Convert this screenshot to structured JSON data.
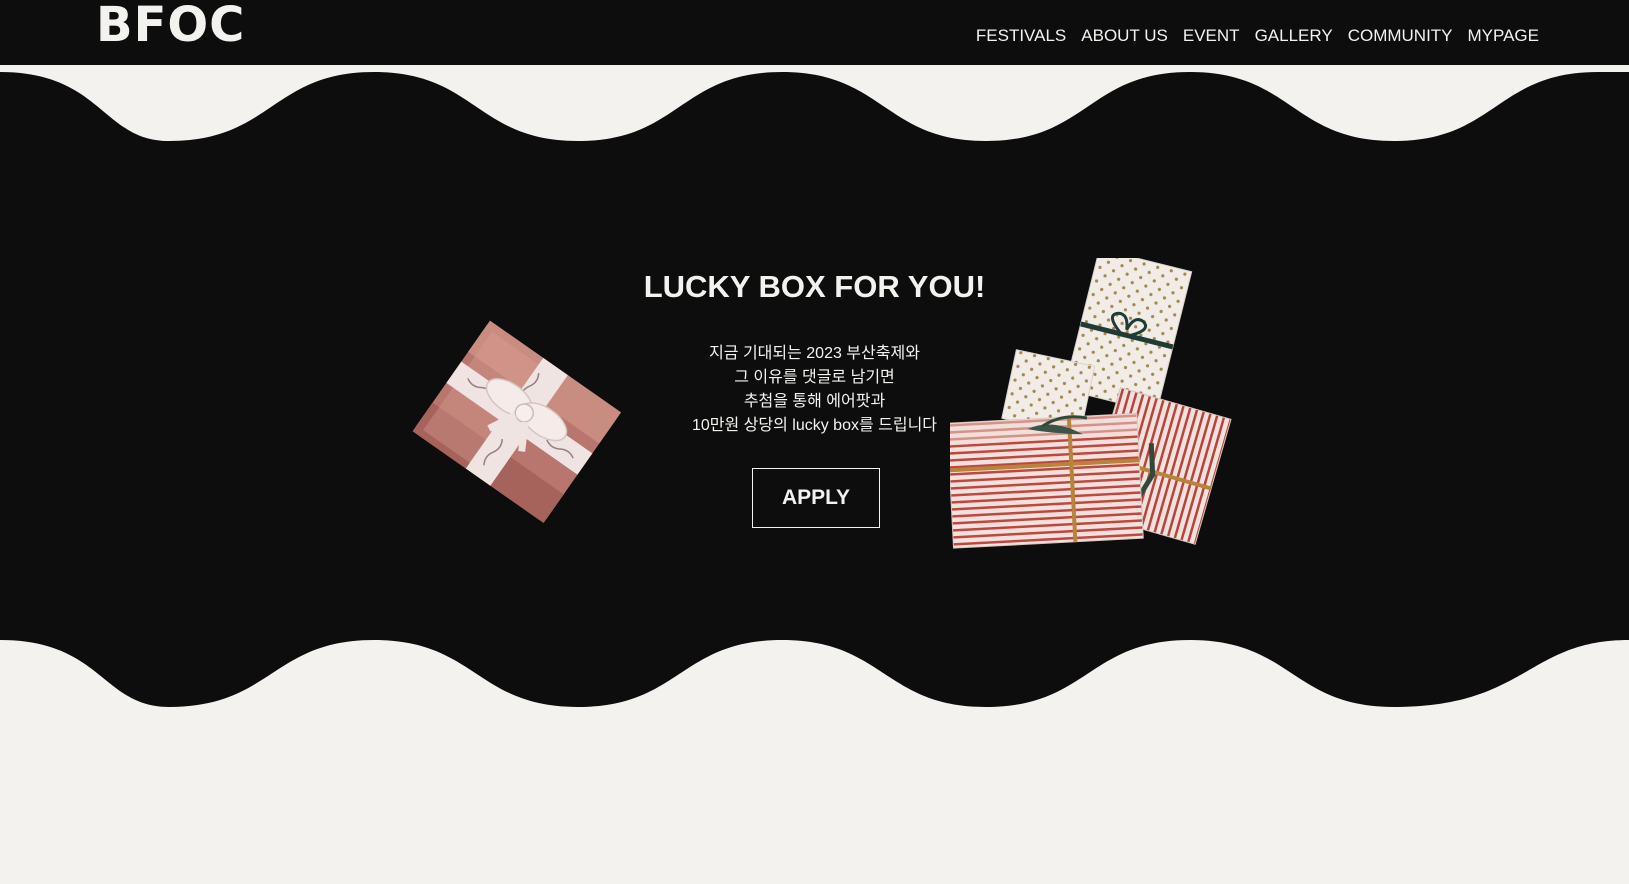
{
  "header": {
    "logo": "BFOC",
    "nav": [
      "FESTIVALS",
      "ABOUT US",
      "EVENT",
      "GALLERY",
      "COMMUNITY",
      "MYPAGE"
    ]
  },
  "hero": {
    "title": "LUCKY BOX FOR YOU!",
    "lines": [
      "지금 기대되는 2023 부산축제와",
      "그 이유를 댓글로 남기면",
      "추첨을 통해 에어팟과",
      "10만원 상당의 lucky box를 드립니다"
    ],
    "apply_label": "APPLY"
  },
  "colors": {
    "dark": "#0d0d0d",
    "light": "#f3f2ef"
  }
}
